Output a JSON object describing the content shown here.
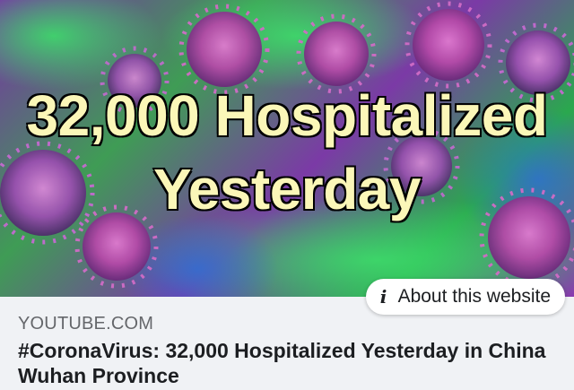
{
  "link_preview": {
    "thumbnail": {
      "headline_line1": "32,000 Hospitalized",
      "headline_line2": "Yesterday",
      "headline_color": "#fbf7b8"
    },
    "about_button": {
      "icon": "info-icon",
      "icon_glyph": "i",
      "label": "About this website"
    },
    "domain": "YOUTUBE.COM",
    "title": "#CoronaVirus: 32,000 Hospitalized Yesterday in China Wuhan Province"
  },
  "colors": {
    "meta_background": "#f0f2f5",
    "domain_text": "#65676b",
    "title_text": "#1c1e21"
  }
}
